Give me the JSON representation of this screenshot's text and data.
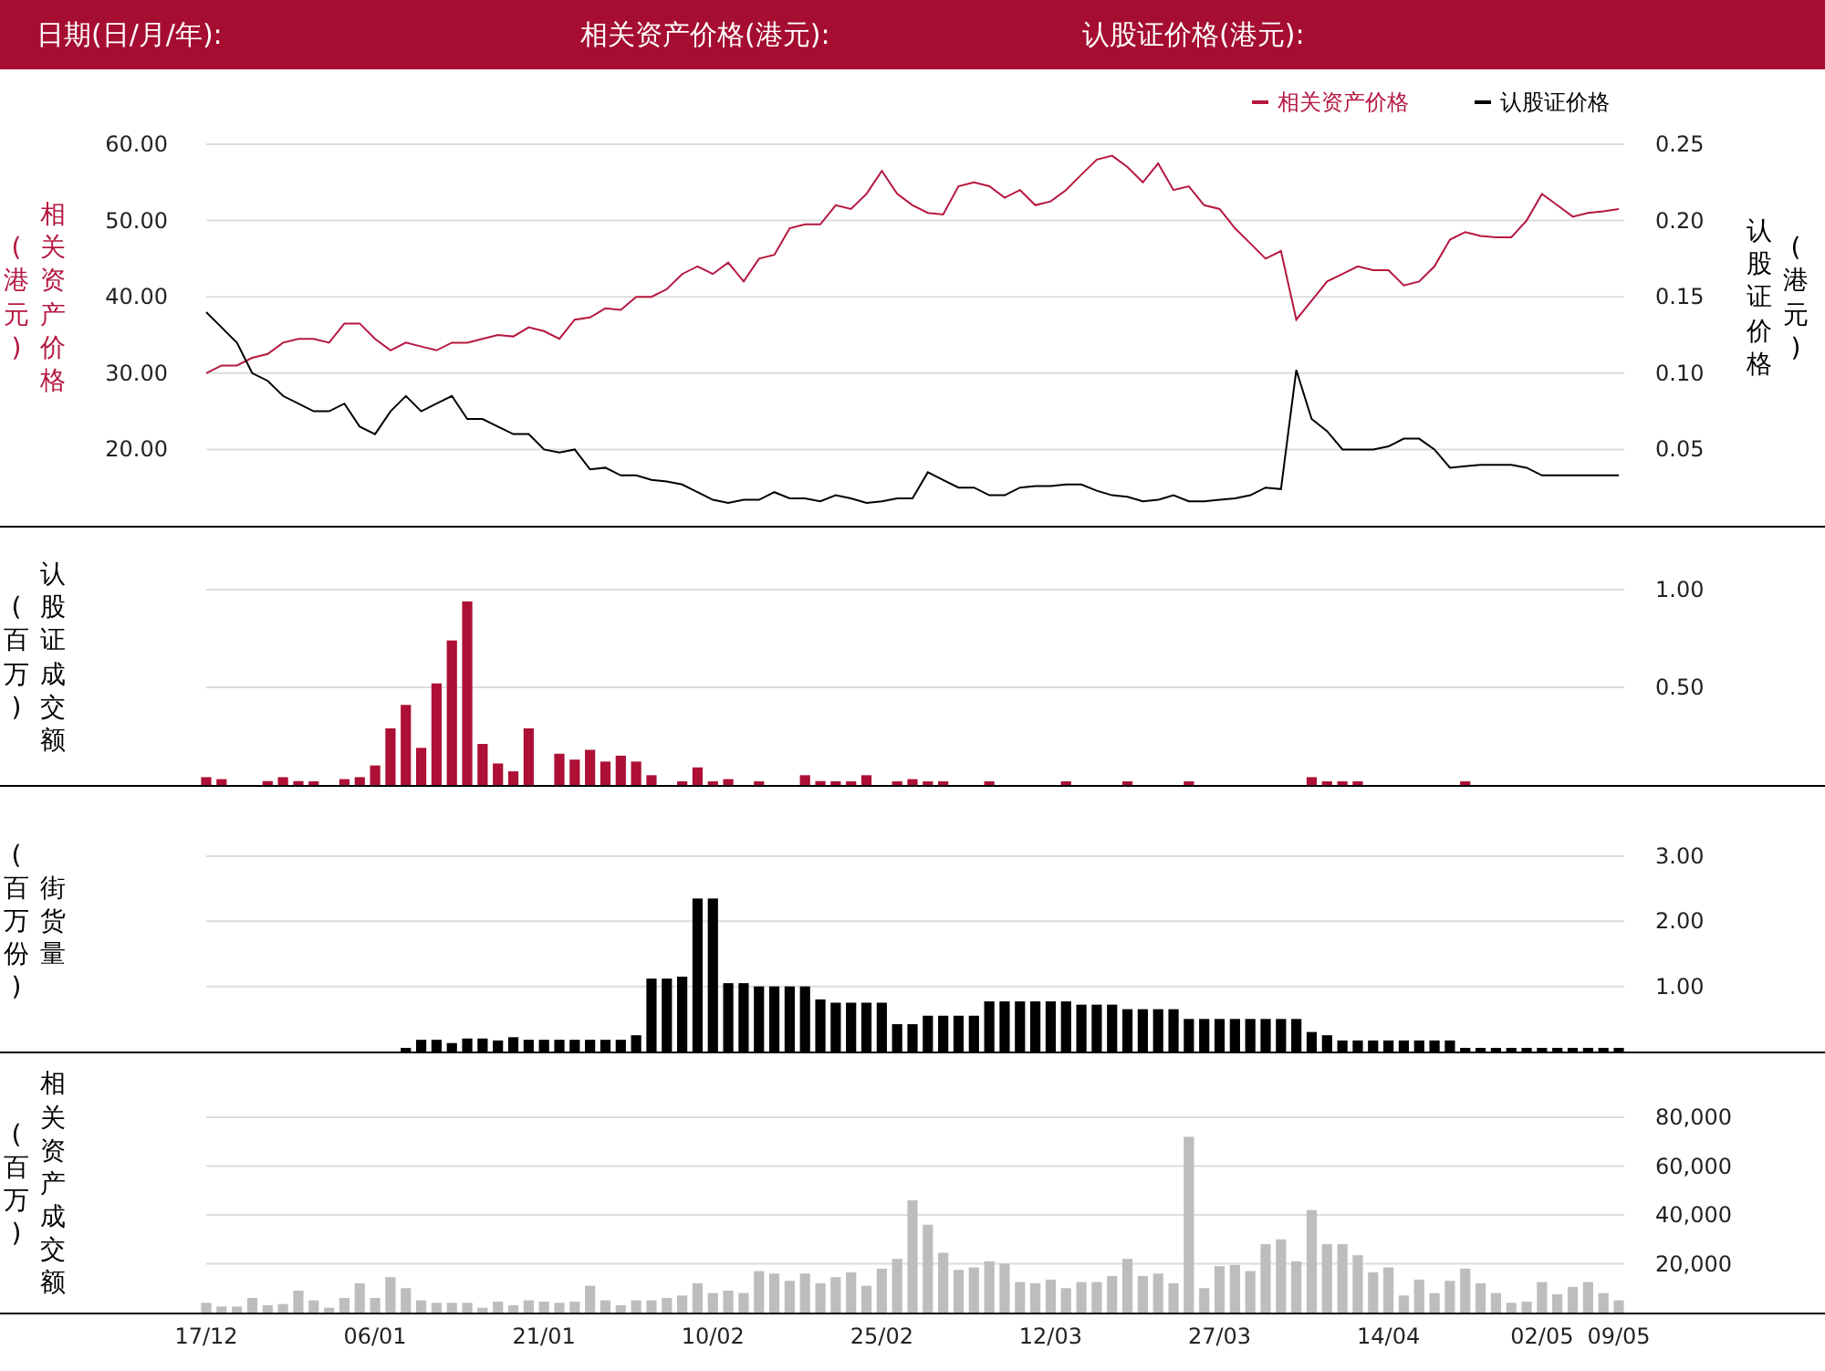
{
  "header": {
    "labels": [
      "日期(日/月/年):",
      "相关资产价格(港元):",
      "认股证价格(港元):"
    ]
  },
  "panels": [
    {
      "left_title": {
        "text": "相关资产价格",
        "unit": "(港元)",
        "color": "#b5173f"
      },
      "right_title": {
        "text": "认股证价格",
        "unit": "(港元)",
        "color": "#000000"
      },
      "chart_data": {
        "type": "line",
        "grid": true,
        "legend": true,
        "ylim": [
          10,
          60
        ],
        "y2lim": [
          0,
          0.25
        ],
        "yticks": [
          {
            "value": 20,
            "label": "20.00"
          },
          {
            "value": 30,
            "label": "30.00"
          },
          {
            "value": 40,
            "label": "40.00"
          },
          {
            "value": 50,
            "label": "50.00"
          },
          {
            "value": 60,
            "label": "60.00"
          }
        ],
        "y2ticks": [
          {
            "value": 0.05,
            "label": "0.05"
          },
          {
            "value": 0.1,
            "label": "0.10"
          },
          {
            "value": 0.15,
            "label": "0.15"
          },
          {
            "value": 0.2,
            "label": "0.20"
          },
          {
            "value": 0.25,
            "label": "0.25"
          }
        ],
        "series": [
          {
            "name": "相关资产价格",
            "color": "#b5173f",
            "values": [
              30,
              31,
              31,
              32,
              32.5,
              34,
              34.5,
              34.5,
              34,
              36.5,
              36.5,
              34.5,
              33,
              34,
              33.5,
              33,
              34,
              34,
              34.5,
              35,
              34.8,
              36,
              35.5,
              34.5,
              37,
              37.3,
              38.5,
              38.3,
              40,
              40,
              41,
              43,
              44,
              43,
              44.5,
              42,
              45,
              45.5,
              49,
              49.5,
              49.5,
              52,
              51.5,
              53.5,
              56.5,
              53.5,
              52,
              51,
              50.8,
              54.5,
              55,
              54.5,
              53,
              54,
              52,
              52.5,
              54,
              56,
              58,
              58.5,
              57,
              55,
              57.5,
              54,
              54.5,
              52,
              51.5,
              49,
              47,
              45,
              46,
              37,
              39.5,
              42,
              43,
              44,
              43.5,
              43.5,
              41.5,
              42,
              44,
              47.5,
              48.5,
              48,
              47.8,
              47.8,
              50,
              53.5,
              52,
              50.5,
              51,
              51.2,
              51.5
            ]
          },
          {
            "name": "认股证价格",
            "color": "#000000",
            "axis": "y2",
            "values": [
              0.14,
              0.13,
              0.12,
              0.1,
              0.095,
              0.085,
              0.08,
              0.075,
              0.075,
              0.08,
              0.065,
              0.06,
              0.075,
              0.085,
              0.075,
              0.08,
              0.085,
              0.07,
              0.07,
              0.065,
              0.06,
              0.06,
              0.05,
              0.048,
              0.05,
              0.037,
              0.038,
              0.033,
              0.033,
              0.03,
              0.029,
              0.027,
              0.022,
              0.017,
              0.015,
              0.017,
              0.017,
              0.022,
              0.018,
              0.018,
              0.016,
              0.02,
              0.018,
              0.015,
              0.016,
              0.018,
              0.018,
              0.035,
              0.03,
              0.025,
              0.025,
              0.02,
              0.02,
              0.025,
              0.026,
              0.026,
              0.027,
              0.027,
              0.023,
              0.02,
              0.019,
              0.016,
              0.017,
              0.02,
              0.016,
              0.016,
              0.017,
              0.018,
              0.02,
              0.025,
              0.024,
              0.102,
              0.07,
              0.062,
              0.05,
              0.05,
              0.05,
              0.052,
              0.057,
              0.057,
              0.05,
              0.038,
              0.039,
              0.04,
              0.04,
              0.04,
              0.038,
              0.033,
              0.033,
              0.033,
              0.033,
              0.033,
              0.033
            ]
          }
        ]
      }
    },
    {
      "left_title": {
        "text": "认股证成交额",
        "unit": "(百万)",
        "color": "#000000"
      },
      "chart_data": {
        "type": "bar",
        "grid": true,
        "ylim": [
          0,
          1
        ],
        "yticks": [
          {
            "value": 0.5,
            "label": "0.50"
          },
          {
            "value": 1,
            "label": "1.00"
          }
        ],
        "series": [
          {
            "color": "#ad0f35",
            "values": [
              0.04,
              0.03,
              0,
              0,
              0.02,
              0.04,
              0.02,
              0.01,
              0,
              0.03,
              0.04,
              0.1,
              0.29,
              0.41,
              0.19,
              0.52,
              0.74,
              0.94,
              0.21,
              0.11,
              0.07,
              0.29,
              0,
              0.16,
              0.13,
              0.18,
              0.12,
              0.15,
              0.12,
              0.05,
              0,
              0.01,
              0.09,
              0.01,
              0.03,
              0,
              0.01,
              0,
              0,
              0.05,
              0.02,
              0.01,
              0.01,
              0.05,
              0,
              0.01,
              0.03,
              0.01,
              0.01,
              0,
              0,
              0.01,
              0,
              0,
              0,
              0,
              0.01,
              0,
              0,
              0,
              0.01,
              0,
              0,
              0,
              0.01,
              0,
              0,
              0,
              0,
              0,
              0,
              0,
              0.04,
              0.01,
              0.01,
              0.01,
              0,
              0,
              0,
              0,
              0,
              0,
              0.01,
              0,
              0,
              0,
              0,
              0,
              0,
              0,
              0,
              0,
              0
            ]
          }
        ]
      }
    },
    {
      "left_title": {
        "text": "街货量",
        "unit": "(百万份)",
        "color": "#000000"
      },
      "chart_data": {
        "type": "bar",
        "grid": true,
        "ylim": [
          0,
          3
        ],
        "yticks": [
          {
            "value": 1,
            "label": "1.00"
          },
          {
            "value": 2,
            "label": "2.00"
          },
          {
            "value": 3,
            "label": "3.00"
          }
        ],
        "series": [
          {
            "color": "#000000",
            "values": [
              0,
              0,
              0,
              0,
              0,
              0,
              0,
              0,
              0,
              0,
              0,
              0,
              0,
              0.05,
              0.18,
              0.18,
              0.13,
              0.2,
              0.2,
              0.17,
              0.22,
              0.18,
              0.18,
              0.18,
              0.18,
              0.18,
              0.18,
              0.18,
              0.25,
              1.12,
              1.12,
              1.15,
              2.35,
              2.35,
              1.05,
              1.05,
              1,
              1,
              1,
              1,
              0.8,
              0.75,
              0.75,
              0.75,
              0.75,
              0.42,
              0.42,
              0.55,
              0.55,
              0.55,
              0.55,
              0.77,
              0.77,
              0.77,
              0.77,
              0.77,
              0.77,
              0.72,
              0.72,
              0.72,
              0.65,
              0.65,
              0.65,
              0.65,
              0.5,
              0.5,
              0.5,
              0.5,
              0.5,
              0.5,
              0.5,
              0.5,
              0.3,
              0.25,
              0.17,
              0.17,
              0.17,
              0.17,
              0.17,
              0.17,
              0.17,
              0.17,
              0.02,
              0.02,
              0.02,
              0.02,
              0.02,
              0.02,
              0.02,
              0.02,
              0.02,
              0.02,
              0.02
            ]
          }
        ]
      }
    },
    {
      "left_title": {
        "text": "相关资产成交额",
        "unit": "(百万)",
        "color": "#000000"
      },
      "chart_data": {
        "type": "bar",
        "grid": true,
        "ylim": [
          0,
          80000
        ],
        "categories": [
          "17/12",
          null,
          null,
          null,
          null,
          null,
          null,
          null,
          null,
          null,
          null,
          "06/01",
          null,
          null,
          null,
          null,
          null,
          null,
          null,
          null,
          null,
          null,
          "21/01",
          null,
          null,
          null,
          null,
          null,
          null,
          null,
          null,
          null,
          null,
          "10/02",
          null,
          null,
          null,
          null,
          null,
          null,
          null,
          null,
          null,
          null,
          "25/02",
          null,
          null,
          null,
          null,
          null,
          null,
          null,
          null,
          null,
          null,
          "12/03",
          null,
          null,
          null,
          null,
          null,
          null,
          null,
          null,
          null,
          null,
          "27/03",
          null,
          null,
          null,
          null,
          null,
          null,
          null,
          null,
          null,
          null,
          "14/04",
          null,
          null,
          null,
          null,
          null,
          null,
          null,
          null,
          null,
          "02/05",
          null,
          null,
          null,
          null,
          "09/05"
        ],
        "yticks": [
          {
            "value": 20000,
            "label": "20,000"
          },
          {
            "value": 40000,
            "label": "40,000"
          },
          {
            "value": 60000,
            "label": "60,000"
          },
          {
            "value": 80000,
            "label": "80,000"
          }
        ],
        "series": [
          {
            "color": "#bdbdbd",
            "values": [
              4000,
              2500,
              2500,
              6000,
              3000,
              3500,
              9000,
              5000,
              2000,
              6000,
              12000,
              6000,
              14500,
              10000,
              5000,
              4000,
              4000,
              4000,
              2000,
              4500,
              3000,
              5000,
              4500,
              4000,
              4500,
              11000,
              5000,
              3000,
              5000,
              5000,
              6000,
              7000,
              12000,
              8000,
              9000,
              8000,
              17000,
              16000,
              13000,
              16000,
              12000,
              14500,
              16500,
              11000,
              18000,
              22000,
              46000,
              36000,
              24500,
              17500,
              18500,
              21000,
              20000,
              12500,
              12000,
              13500,
              10000,
              12500,
              12500,
              15000,
              22000,
              15000,
              16000,
              12000,
              72000,
              10000,
              19000,
              19500,
              17000,
              28000,
              30000,
              21000,
              42000,
              28000,
              28000,
              23500,
              16500,
              18500,
              7000,
              13500,
              8000,
              13000,
              18000,
              12000,
              8000,
              4000,
              4500,
              12500,
              7500,
              10500,
              12500,
              8000,
              5000
            ]
          }
        ]
      }
    }
  ]
}
